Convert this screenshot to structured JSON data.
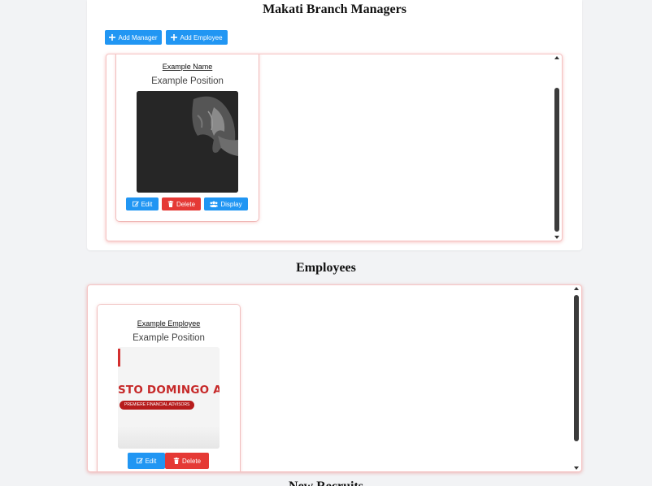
{
  "managers_section": {
    "title": "Makati Branch Managers",
    "add_manager_label": "Add Manager",
    "add_employee_label": "Add Employee",
    "cards": [
      {
        "name": "Example Name",
        "position": "Example Position",
        "photo": "dark-portrait",
        "edit_label": "Edit",
        "delete_label": "Delete",
        "display_label": "Display"
      }
    ]
  },
  "employees_section": {
    "title": "Employees",
    "cards": [
      {
        "name": "Example Employee",
        "position": "Example Position",
        "photo_banner_text": "STO DOMINGO AS",
        "photo_tagline": "PREMIERE FINANCIAL ADVISORS",
        "edit_label": "Edit",
        "delete_label": "Delete"
      }
    ]
  },
  "next_section": {
    "title": "New Recruits"
  },
  "colors": {
    "primary": "#2196f3",
    "danger": "#e53935",
    "panel_border": "#f5c4c4"
  }
}
